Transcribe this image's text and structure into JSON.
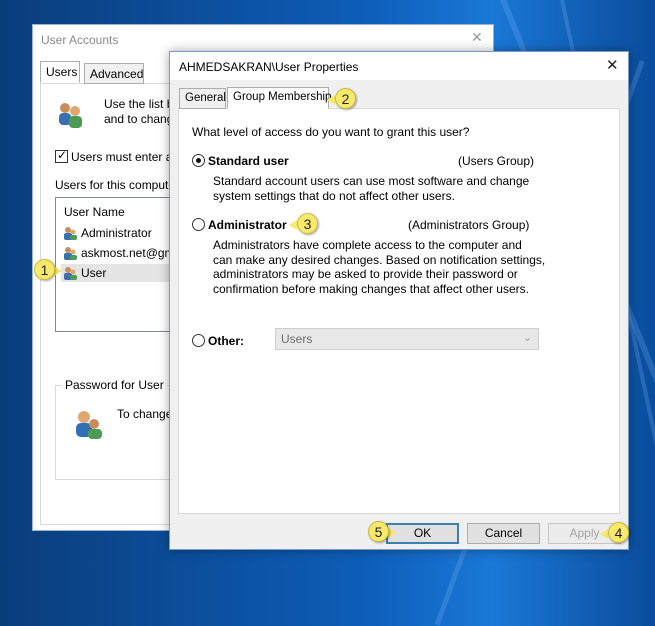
{
  "user_accounts": {
    "title": "User Accounts",
    "close_glyph": "✕",
    "tabs": [
      "Users",
      "Advanced"
    ],
    "intro_line1": "Use the list b",
    "intro_line2": "and to chang",
    "checkbox_label": "Users must enter a",
    "users_label": "Users for this compute",
    "list_header": "User Name",
    "users": [
      "Administrator",
      "askmost.net@gm",
      "User"
    ],
    "password_group_title": "Password for User",
    "password_text": "To change"
  },
  "user_properties": {
    "title": "AHMEDSAKRAN\\User Properties",
    "close_glyph": "✕",
    "tabs": [
      "General",
      "Group Membership"
    ],
    "question": "What level of access do you want to grant this user?",
    "options": {
      "standard": {
        "label": "Standard user",
        "group": "(Users Group)",
        "selected": true,
        "desc1": "Standard account users can use most software and change",
        "desc2": "system settings that do not affect other users."
      },
      "admin": {
        "label": "Administrator",
        "group": "(Administrators Group)",
        "selected": false,
        "desc1": "Administrators have complete access to the computer and",
        "desc2": "can make any desired changes. Based on notification settings,",
        "desc3": "administrators may be asked to provide their password or",
        "desc4": "confirmation before making changes that affect other users."
      },
      "other": {
        "label": "Other:",
        "selected": false,
        "select_value": "Users",
        "chevron_glyph": "⌄"
      }
    },
    "buttons": {
      "ok": "OK",
      "cancel": "Cancel",
      "apply": "Apply"
    }
  },
  "callouts": [
    "1",
    "2",
    "3",
    "4",
    "5"
  ],
  "colors": {
    "callout_fill": "#f7e96b",
    "default_button_border": "#3c7fb1",
    "desktop_blue": "#0d5db8"
  }
}
